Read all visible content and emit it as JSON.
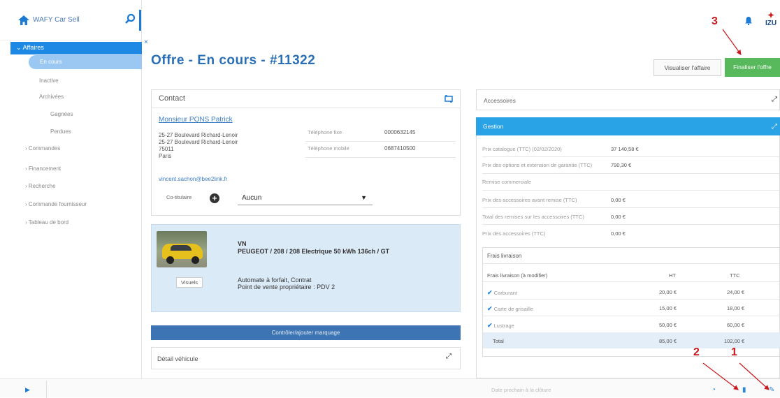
{
  "app": {
    "name": "WAFY Car Sell"
  },
  "sidebar": {
    "active_section": "Affaires",
    "items": [
      {
        "label": "En cours"
      },
      {
        "label": "Inactive"
      },
      {
        "label": "Archivées"
      },
      {
        "label": "Gagnées"
      },
      {
        "label": "Perdues"
      },
      {
        "label": "Commandes"
      },
      {
        "label": "Financement"
      },
      {
        "label": "Recherche"
      },
      {
        "label": "Commande fournisseur"
      },
      {
        "label": "Tableau de bord"
      }
    ]
  },
  "page": {
    "title": "Offre - En cours - #11322",
    "close_glyph": "×"
  },
  "actions": {
    "visualiser": "Visualiser l'affaire",
    "finaliser": "Finaliser l'offre"
  },
  "annotations": {
    "a1": "1",
    "a2": "2",
    "a3": "3"
  },
  "contact": {
    "title": "Contact",
    "name": "Monsieur PONS Patrick",
    "address1": "25-27 Boulevard Richard-Lenoir",
    "address2": "25-27 Boulevard Richard-Lenoir",
    "zip": "75011",
    "city": "Paris",
    "phone_fixed_label": "Téléphone fixe",
    "phone_fixed": "0000632145",
    "phone_mobile_label": "Téléphone mobile",
    "phone_mobile": "0687410500",
    "email": "vincent.sachon@bee2link.fr",
    "coowner_label": "Co-titulaire",
    "coowner_value": "Aucun"
  },
  "vehicle": {
    "type": "VN",
    "model": "PEUGEOT / 208 / 208 Electrique 50 kWh 136ch / GT",
    "line1": "Automate à forfait, Contrat",
    "line2": "Point de vente propriétaire : PDV 2",
    "visuels_label": "Visuels",
    "bar_label": "Contrôler/ajouter marquage",
    "detail_label": "Détail véhicule"
  },
  "accessories": {
    "title": "Accessoires"
  },
  "gestion": {
    "title": "Gestion",
    "rows": [
      {
        "label": "Prix catalogue (TTC) (02/02/2020)",
        "value": "37 140,58 €"
      },
      {
        "label": "Prix des options et extension de garantie (TTC)",
        "value": "790,30 €"
      },
      {
        "label": "Remise commerciale",
        "value": ""
      },
      {
        "label": "Prix des accessoires avant remise (TTC)",
        "value": "0,00 €"
      },
      {
        "label": "Total des remises sur les accessoires (TTC)",
        "value": "0,00 €"
      },
      {
        "label": "Prix des accessoires (TTC)",
        "value": "0,00 €"
      }
    ]
  },
  "frais": {
    "title": "Frais livraison",
    "head_label": "Frais livraison (à modifier)",
    "head_ht": "HT",
    "head_ttc": "TTC",
    "rows": [
      {
        "label": "Carburant",
        "ht": "20,00 €",
        "ttc": "24,00 €"
      },
      {
        "label": "Carte de grisaille",
        "ht": "15,00 €",
        "ttc": "18,00 €"
      },
      {
        "label": "Lustrage",
        "ht": "50,00 €",
        "ttc": "60,00 €"
      }
    ],
    "total_label": "Total",
    "total_ht": "85,00 €",
    "total_ttc": "102,00 €"
  },
  "footer": {
    "text": "Date prochain à la clôture"
  },
  "colors": {
    "primary": "#1e88e5",
    "success": "#57b95c",
    "annotation": "#c8191f"
  }
}
